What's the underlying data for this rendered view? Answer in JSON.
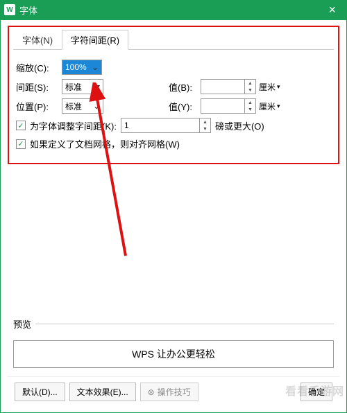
{
  "titlebar": {
    "logo": "W",
    "title": "字体"
  },
  "tabs": {
    "font": "字体(N)",
    "spacing": "字符间距(R)"
  },
  "form": {
    "scale_label": "缩放(C):",
    "scale_value": "100%",
    "spacing_label": "间距(S):",
    "spacing_value": "标准",
    "position_label": "位置(P):",
    "position_value": "标准",
    "value_b_label": "值(B):",
    "value_b_value": "",
    "value_y_label": "值(Y):",
    "value_y_value": "",
    "unit_b": "厘米",
    "unit_y": "厘米",
    "kerning_label": "为字体调整字间距(K):",
    "kerning_value": "1",
    "kerning_unit": "磅或更大(O)",
    "snap_grid_label": "如果定义了文档网格，则对齐网格(W)"
  },
  "preview": {
    "label": "预览",
    "text": "WPS 让办公更轻松"
  },
  "footer": {
    "default_btn": "默认(D)...",
    "text_effect_btn": "文本效果(E)...",
    "tips_btn": "操作技巧",
    "ok_btn": "确定"
  },
  "watermark": "看看手游网"
}
